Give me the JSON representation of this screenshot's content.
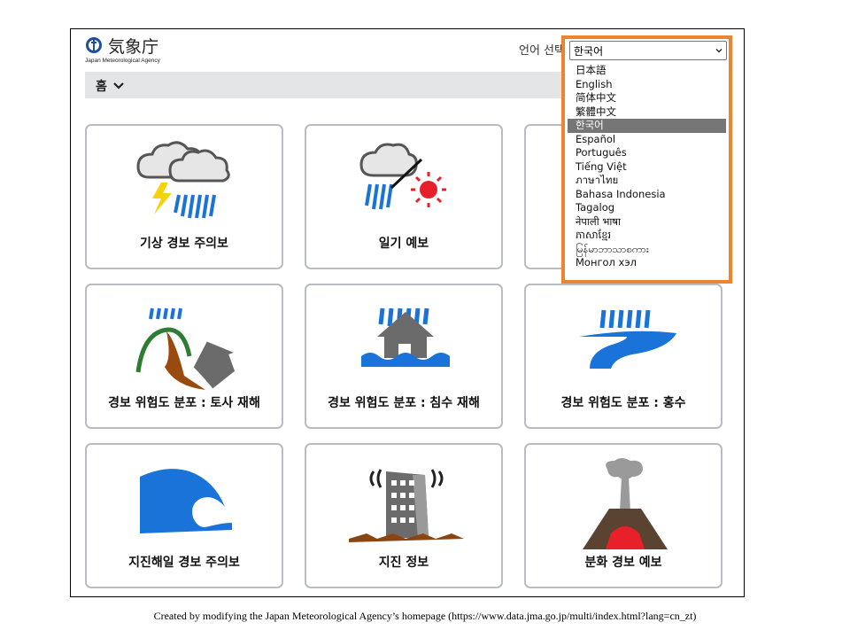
{
  "header": {
    "logo_text": "気象庁",
    "logo_sub": "Japan Meteorological Agency",
    "lang_label": "언어 선택",
    "lang_selected": "한국어"
  },
  "nav": {
    "home": "홈"
  },
  "cards": [
    {
      "label": "기상 경보 주의보"
    },
    {
      "label": "일기 예보"
    },
    {
      "label": ""
    },
    {
      "label": "경보 위험도 분포 : 토사 재해"
    },
    {
      "label": "경보 위험도 분포 : 침수 재해"
    },
    {
      "label": "경보 위험도 분포 : 홍수"
    },
    {
      "label": "지진해일 경보 주의보"
    },
    {
      "label": "지진 정보"
    },
    {
      "label": "분화 경보 예보"
    }
  ],
  "language_options": [
    "日本語",
    "English",
    "简体中文",
    "繁體中文",
    "한국어",
    "Español",
    "Português",
    "Tiếng Việt",
    "ภาษาไทย",
    "Bahasa Indonesia",
    "Tagalog",
    "नेपाली भाषा",
    "ភាសាខ្មែរ",
    "မြန်မာဘာသာစကား",
    "Монгол хэл"
  ],
  "selected_language_index": 4,
  "colors": {
    "highlight": "#ec8432",
    "selected_option": "#767676",
    "rain": "#1a73d9"
  },
  "caption": "Created by modifying the Japan Meteorological Agency’s homepage (https://www.data.jma.go.jp/multi/index.html?lang=cn_zt)"
}
